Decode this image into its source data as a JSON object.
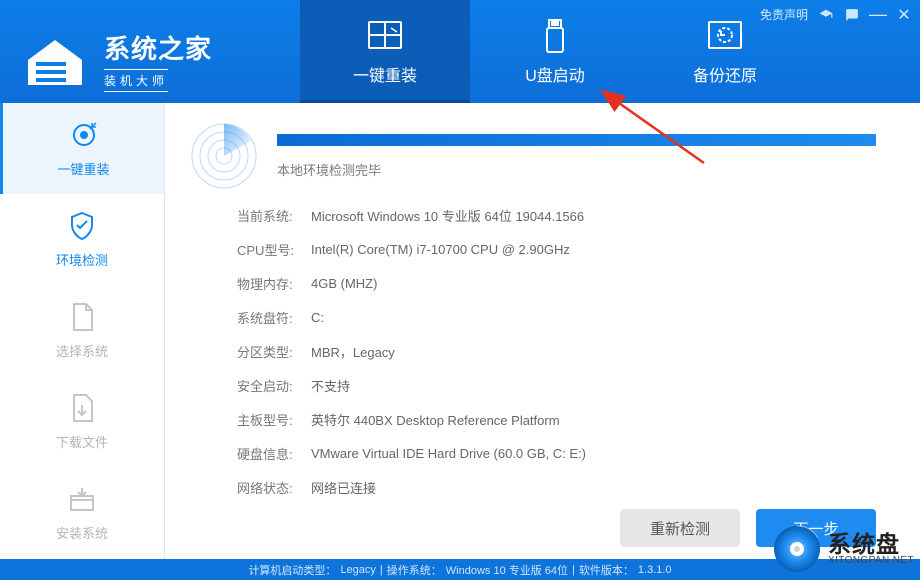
{
  "windowControls": {
    "disclaimer": "免责声明"
  },
  "logo": {
    "title": "系统之家",
    "subtitle": "装机大师"
  },
  "navTabs": [
    {
      "id": "reinstall",
      "label": "一键重装",
      "active": true
    },
    {
      "id": "usb-boot",
      "label": "U盘启动",
      "active": false
    },
    {
      "id": "backup-restore",
      "label": "备份还原",
      "active": false
    }
  ],
  "sidebar": [
    {
      "id": "one-click",
      "label": "一键重装",
      "state": "active"
    },
    {
      "id": "env-check",
      "label": "环境检测",
      "state": "current"
    },
    {
      "id": "select-system",
      "label": "选择系统",
      "state": ""
    },
    {
      "id": "download-file",
      "label": "下载文件",
      "state": ""
    },
    {
      "id": "install-system",
      "label": "安装系统",
      "state": ""
    }
  ],
  "scan": {
    "progressPercent": 100,
    "statusText": "本地环境检测完毕"
  },
  "info": [
    {
      "label": "当前系统:",
      "value": "Microsoft Windows 10 专业版 64位 19044.1566"
    },
    {
      "label": "CPU型号:",
      "value": "Intel(R) Core(TM) i7-10700 CPU @ 2.90GHz"
    },
    {
      "label": "物理内存:",
      "value": "4GB (MHZ)"
    },
    {
      "label": "系统盘符:",
      "value": "C:"
    },
    {
      "label": "分区类型:",
      "value": "MBR，Legacy"
    },
    {
      "label": "安全启动:",
      "value": "不支持"
    },
    {
      "label": "主板型号:",
      "value": "英特尔 440BX Desktop Reference Platform"
    },
    {
      "label": "硬盘信息:",
      "value": "VMware Virtual IDE Hard Drive  (60.0 GB, C: E:)"
    },
    {
      "label": "网络状态:",
      "value": "网络已连接"
    }
  ],
  "buttons": {
    "rescan": "重新检测",
    "next": "下一步"
  },
  "footer": {
    "bootTypeLabel": "计算机启动类型：",
    "bootType": "Legacy",
    "osLabel": "操作系统：",
    "os": "Windows 10 专业版 64位",
    "swVersionLabel": "软件版本：",
    "swVersion": "1.3.1.0"
  },
  "watermark": {
    "main": "系统盘",
    "sub": "XITONGPAN.NET"
  }
}
